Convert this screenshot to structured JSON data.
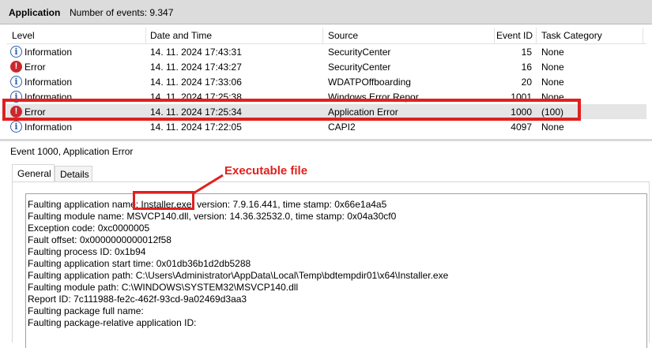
{
  "header": {
    "title": "Application",
    "event_count": "Number of events: 9.347"
  },
  "table": {
    "columns": [
      "Level",
      "Date and Time",
      "Source",
      "Event ID",
      "Task Category"
    ],
    "rows": [
      {
        "level": "Information",
        "icon": "information-icon",
        "datetime": "14. 11. 2024 17:43:31",
        "source": "SecurityCenter",
        "event_id": "15",
        "task": "None"
      },
      {
        "level": "Error",
        "icon": "error-icon",
        "datetime": "14. 11. 2024 17:43:27",
        "source": "SecurityCenter",
        "event_id": "16",
        "task": "None"
      },
      {
        "level": "Information",
        "icon": "information-icon",
        "datetime": "14. 11. 2024 17:33:06",
        "source": "WDATPOffboarding",
        "event_id": "20",
        "task": "None"
      },
      {
        "level": "Information",
        "icon": "information-icon",
        "datetime": "14. 11. 2024 17:25:38",
        "source": "Windows Error Repor",
        "event_id": "1001",
        "task": "None"
      },
      {
        "level": "Error",
        "icon": "error-icon",
        "datetime": "14. 11. 2024 17:25:34",
        "source": "Application Error",
        "event_id": "1000",
        "task": "(100)"
      },
      {
        "level": "Information",
        "icon": "information-icon",
        "datetime": "14. 11. 2024 17:22:05",
        "source": "CAPI2",
        "event_id": "4097",
        "task": "None"
      }
    ]
  },
  "detail": {
    "title": "Event 1000, Application Error",
    "tabs": [
      "General",
      "Details"
    ],
    "lines": [
      "Faulting application name: Installer.exe, version: 7.9.16.441, time stamp: 0x66e1a4a5",
      "Faulting module name: MSVCP140.dll, version: 14.36.32532.0, time stamp: 0x04a30cf0",
      "Exception code: 0xc0000005",
      "Fault offset: 0x0000000000012f58",
      "Faulting process ID: 0x1b94",
      "Faulting application start time: 0x01db36b1d2db5288",
      "Faulting application path: C:\\Users\\Administrator\\AppData\\Local\\Temp\\bdtempdir01\\x64\\Installer.exe",
      "Faulting module path: C:\\WINDOWS\\SYSTEM32\\MSVCP140.dll",
      "Report ID: 7c111988-fe2c-462f-93cd-9a02469d3aa3",
      "Faulting package full name:",
      "Faulting package-relative application ID:"
    ]
  },
  "annotation": {
    "label": "Executable file",
    "color": "#e0201f"
  },
  "colors": {
    "selected_row": "#e5e5e5",
    "error_icon": "#c9292e",
    "info_icon": "#2f5fb3"
  }
}
